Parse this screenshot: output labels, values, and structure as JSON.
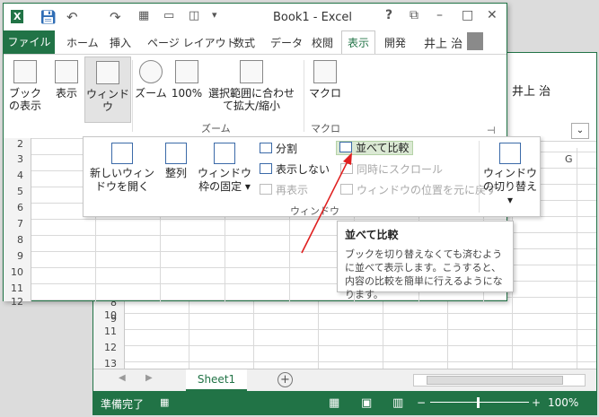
{
  "back_window": {
    "user": "井上 治",
    "col_g": "G",
    "rows": [
      "8",
      "9",
      "10",
      "11",
      "12",
      "13"
    ],
    "sheet_tab": "Sheet1",
    "status": "準備完了",
    "zoom": "100%"
  },
  "front_window": {
    "title": "Book1 - Excel",
    "help": "?",
    "tabs": {
      "file": "ファイル",
      "home": "ホーム",
      "insert": "挿入",
      "layout": "ページ レイアウト",
      "formulas": "数式",
      "data": "データ",
      "review": "校閲",
      "view": "表示",
      "developer": "開発"
    },
    "user": "井上 治",
    "ribbon": {
      "book_view": "ブックの表示",
      "show": "表示",
      "window": "ウィンドウ",
      "zoom": "ズーム",
      "zoom100": "100%",
      "zoom_selection": "選択範囲に合わせて拡大/縮小",
      "group_zoom": "ズーム",
      "macro": "マクロ",
      "group_macro": "マクロ"
    },
    "rows": [
      "2",
      "3",
      "4",
      "5",
      "6",
      "7",
      "8",
      "9",
      "10",
      "11",
      "12"
    ]
  },
  "popup": {
    "new_window": "新しいウィンドウを開く",
    "arrange": "整列",
    "freeze": "ウィンドウ枠の固定",
    "split": "分割",
    "hide": "表示しない",
    "unhide": "再表示",
    "side_by_side": "並べて比較",
    "sync_scroll": "同時にスクロール",
    "reset_position": "ウィンドウの位置を元に戻す",
    "switch_windows": "ウィンドウの切り替え",
    "group_label": "ウィンドウ"
  },
  "tooltip": {
    "title": "並べて比較",
    "description": "ブックを切り替えなくても済むように並べて表示します。こうすると、内容の比較を簡単に行えるようになります。"
  },
  "colors": {
    "excel_green": "#217346",
    "arrow_red": "#e02020"
  }
}
